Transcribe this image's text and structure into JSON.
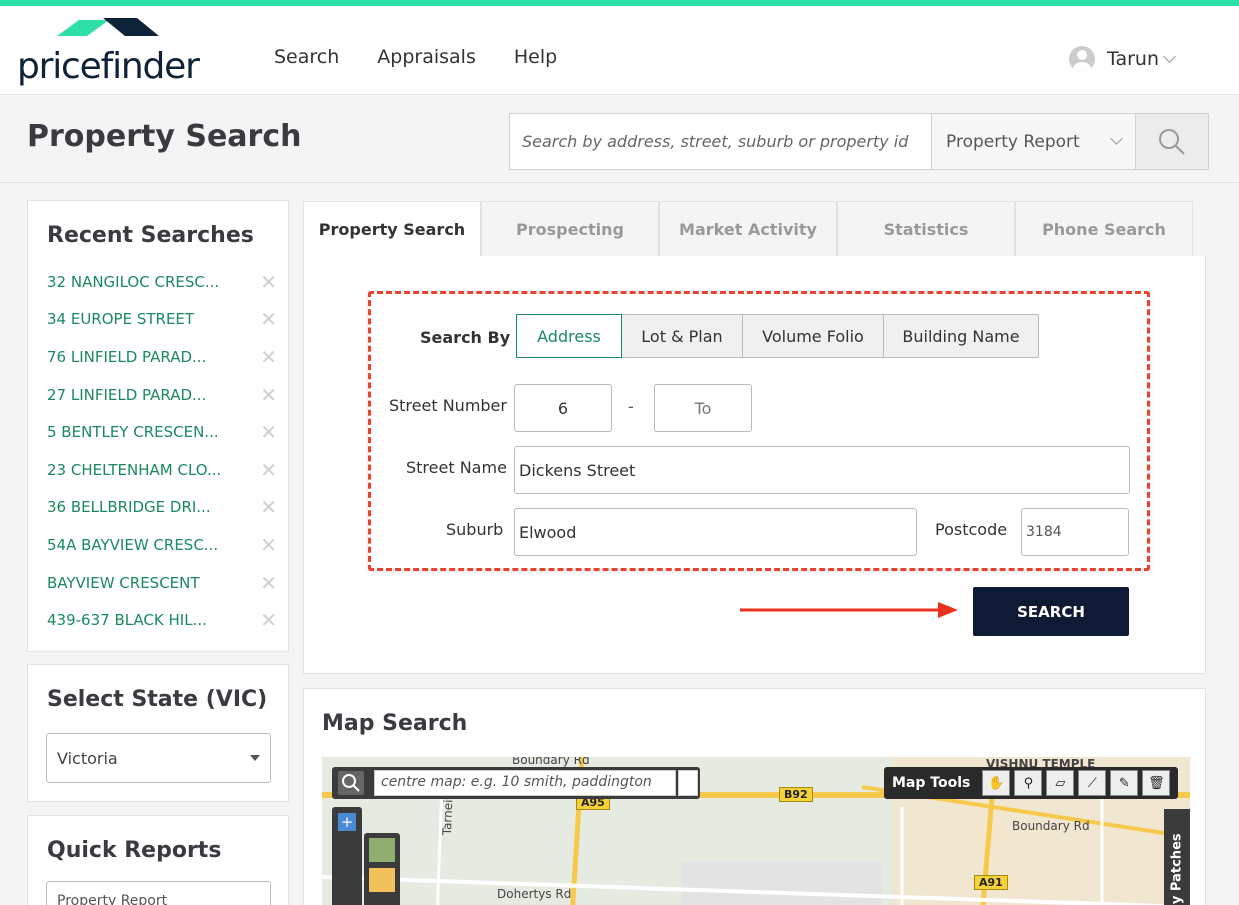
{
  "brand": {
    "name": "pricefinder",
    "accent": "#2ee0a8",
    "navy": "#0f1a34"
  },
  "nav": {
    "items": [
      "Search",
      "Appraisals",
      "Help"
    ]
  },
  "user": {
    "name": "Tarun"
  },
  "page": {
    "title": "Property Search"
  },
  "global_search": {
    "placeholder": "Search by address, street, suburb or property id",
    "report_type": "Property Report"
  },
  "recent": {
    "title": "Recent Searches",
    "items": [
      "32 NANGILOC CRESC...",
      "34 EUROPE STREET",
      "76 LINFIELD PARAD...",
      "27 LINFIELD PARAD...",
      "5 BENTLEY CRESCEN...",
      "23 CHELTENHAM CLO...",
      "36 BELLBRIDGE DRI...",
      "54A BAYVIEW CRESC...",
      "BAYVIEW CRESCENT",
      "439-637 BLACK HIL..."
    ]
  },
  "state": {
    "title": "Select State (VIC)",
    "selected": "Victoria"
  },
  "quick": {
    "title": "Quick Reports",
    "selected": "Property Report"
  },
  "tabs": [
    "Property Search",
    "Prospecting",
    "Market Activity",
    "Statistics",
    "Phone Search"
  ],
  "form": {
    "search_by_label": "Search By",
    "search_by_options": [
      "Address",
      "Lot & Plan",
      "Volume Folio",
      "Building Name"
    ],
    "street_number_label": "Street Number",
    "street_number": "6",
    "to_placeholder": "To",
    "range_sep": "-",
    "street_name_label": "Street Name",
    "street_name": "Dickens Street",
    "suburb_label": "Suburb",
    "suburb": "Elwood",
    "postcode_label": "Postcode",
    "postcode": "3184",
    "submit": "SEARCH"
  },
  "map": {
    "title": "Map Search",
    "placeholder": "centre map: e.g. 10 smith, paddington",
    "tools_label": "Map Tools",
    "side_label": "My Patches",
    "labels": [
      "Boundary Rd",
      "Boundary Rd",
      "Dohertys Rd",
      "Tarneit",
      "VISHNU TEMPLE"
    ],
    "shields": [
      "A95",
      "B92",
      "A91"
    ]
  }
}
